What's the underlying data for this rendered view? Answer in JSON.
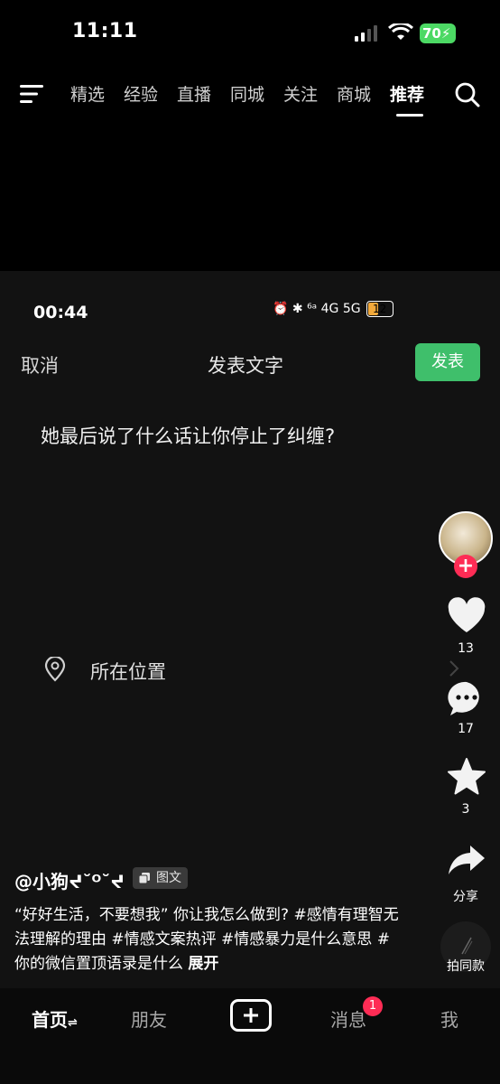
{
  "status_bar": {
    "time": "11:11",
    "battery": "70"
  },
  "top_nav": {
    "tabs": [
      "精选",
      "经验",
      "直播",
      "同城",
      "关注",
      "商城",
      "推荐"
    ],
    "active_tab": "推荐"
  },
  "embedded_screen": {
    "status_time": "00:44",
    "status_icons": "⏰ ✱ ⁶ᵃ 4G 5G",
    "battery": "12",
    "cancel_label": "取消",
    "title": "发表文字",
    "publish_label": "发表",
    "post_text": "她最后说了什么话让你停止了纠缠?",
    "location_label": "所在位置"
  },
  "actions": {
    "like_count": "13",
    "comment_count": "17",
    "favorite_count": "3",
    "share_label": "分享",
    "make_same_label": "拍同款"
  },
  "post": {
    "author": "@小狗ᔪ˘ᴼ˘ᔪ",
    "badge": "图文",
    "caption": "“好好生活，不要想我” 你让我怎么做到? #感情有理智无法理解的理由 #情感文案热评 #情感暴力是什么意思 #你的微信置顶语录是什么",
    "expand_label": "展开"
  },
  "bottom_nav": {
    "home": "首页",
    "friends": "朋友",
    "messages": "消息",
    "messages_badge": "1",
    "me": "我"
  },
  "colors": {
    "accent_red": "#fe2c55",
    "publish_green": "#3fbf6b",
    "battery_green": "#4cd964"
  }
}
